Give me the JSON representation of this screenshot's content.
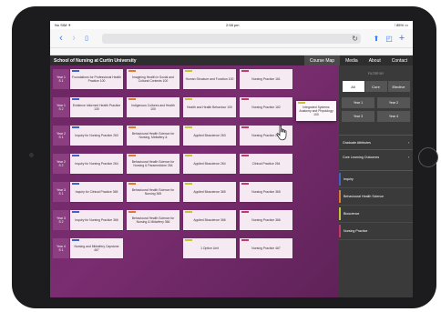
{
  "status": {
    "carrier": "No SIM ✈",
    "time": "2:58 pm",
    "battery": "⁝ 85% ▭"
  },
  "site": {
    "title": "School of Nursing at Curtin University",
    "nav": [
      "Course Map",
      "Media",
      "About",
      "Contact"
    ]
  },
  "rows": [
    "Year 1\nS 1",
    "Year 1\nS 2",
    "Year 2\nS 1",
    "Year 2\nS 2",
    "Year 3\nS 1",
    "Year 3\nS 2",
    "Year 4\nS 1"
  ],
  "cards": [
    [
      "Foundations for Professional Health Practice 100",
      "Imagining Health in Social and Cultural Contexts 100",
      "Human Structure and Function 100",
      "Nursing Practice 161"
    ],
    [
      "Evidence Informed Health Practice 130",
      "Indigenous Cultures and Health 100",
      "Health and Health Behaviour 100",
      "Nursing Practice 162",
      "Integrated Systems Anatomy and Physiology 100"
    ],
    [
      "Inquiry for Nursing Practice 263",
      "Behavioural Health Science for Nursing, Midwifery &",
      "Applied Bioscience 263",
      "Nursing Practice 263"
    ],
    [
      "Inquiry for Nursing Practice 264",
      "Behavioural Health Science for Nursing & Paramedicine 264",
      "Applied Bioscience 264",
      "Clinical Practice 264"
    ],
    [
      "Inquiry for Clinical Practice 365",
      "Behavioural Health Science for Nursing 365",
      "Applied Bioscience 365",
      "Nursing Practice 365"
    ],
    [
      "Inquiry for Nursing Practice 366",
      "Behavioural Health Science for Nursing & Midwifery 366",
      "Applied Bioscience 366",
      "Nursing Practice 366"
    ],
    [
      "Nursing and Midwifery Capstone 467",
      "",
      "1 Option Unit",
      "Nursing Practice 467"
    ]
  ],
  "sidebar": {
    "filter_title": "FILTER BY",
    "types": [
      "All",
      "Core",
      "Elective"
    ],
    "years": [
      "Year 1",
      "Year 2",
      "Year 3",
      "Year 4"
    ],
    "graduate": "Graduate Attributes",
    "outcomes": "Core Learning Outcomes",
    "arrow": "›",
    "legend": [
      "Inquiry",
      "Behavioural Health Science",
      "Bioscience",
      "Nursing Practice"
    ]
  },
  "colors": {
    "inquiry": "#3f64c8",
    "behavioural": "#e07a2e",
    "bioscience": "#c6c23a",
    "nursing": "#c23b6a"
  }
}
